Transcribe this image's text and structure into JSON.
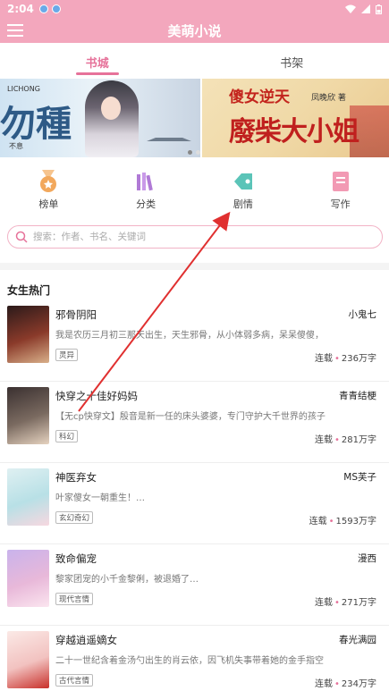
{
  "status": {
    "time": "2:04"
  },
  "app": {
    "title": "美萌小说"
  },
  "tabs": [
    {
      "label": "书城",
      "active": true
    },
    {
      "label": "书架",
      "active": false
    }
  ],
  "banner": {
    "left": {
      "big_char": "勿種",
      "small_top": "LICHONG",
      "small_bot": "不息"
    },
    "right": {
      "subtitle": "傻女逆天",
      "author": "凤晚欣 著",
      "title": "廢柴大小姐"
    }
  },
  "quick_nav": [
    {
      "label": "榜单",
      "icon": "medal-icon",
      "color": "#f2a85c"
    },
    {
      "label": "分类",
      "icon": "books-icon",
      "color": "#b07ad6"
    },
    {
      "label": "剧情",
      "icon": "tag-icon",
      "color": "#5bc4b8"
    },
    {
      "label": "写作",
      "icon": "note-icon",
      "color": "#f29ab4"
    }
  ],
  "search": {
    "placeholder": "搜索：作者、书名、关键词"
  },
  "section": {
    "title": "女生热门"
  },
  "books": [
    {
      "title": "邪骨阴阳",
      "author": "小鬼七",
      "desc": "我是农历三月初三那天出生，天生邪骨，从小体弱多病，呆呆傻傻，",
      "tag": "灵异",
      "status": "连载",
      "words": "236万字",
      "cover": [
        "#2b1a1a",
        "#8a3a2a",
        "#d9b08a"
      ]
    },
    {
      "title": "快穿之十佳好妈妈",
      "author": "青青结梗",
      "desc": "【无cp快穿文】殷音是新一任的床头婆婆，专门守护大千世界的孩子",
      "tag": "科幻",
      "status": "连载",
      "words": "281万字",
      "cover": [
        "#3a3030",
        "#7a6a60",
        "#e6d3c0"
      ]
    },
    {
      "title": "神医弃女",
      "author": "MS芙子",
      "desc": "叶家傻女一朝重生！…",
      "tag": "玄幻奇幻",
      "status": "连载",
      "words": "1593万字",
      "cover": [
        "#dff0f2",
        "#b8e0e6",
        "#f7d8e0"
      ]
    },
    {
      "title": "致命偏宠",
      "author": "漫西",
      "desc": "黎家团宠的小千金黎俐，被退婚了…",
      "tag": "现代言情",
      "status": "连载",
      "words": "271万字",
      "cover": [
        "#c9b3ec",
        "#e8b8d9",
        "#fbe5ef"
      ]
    },
    {
      "title": "穿越逍遥嫡女",
      "author": "春光满园",
      "desc": "二十一世纪含着金汤勺出生的肖云依，因飞机失事带着她的金手指空",
      "tag": "古代言情",
      "status": "连载",
      "words": "234万字",
      "cover": [
        "#fbe9e6",
        "#f2c2c0",
        "#c8302a"
      ]
    }
  ]
}
